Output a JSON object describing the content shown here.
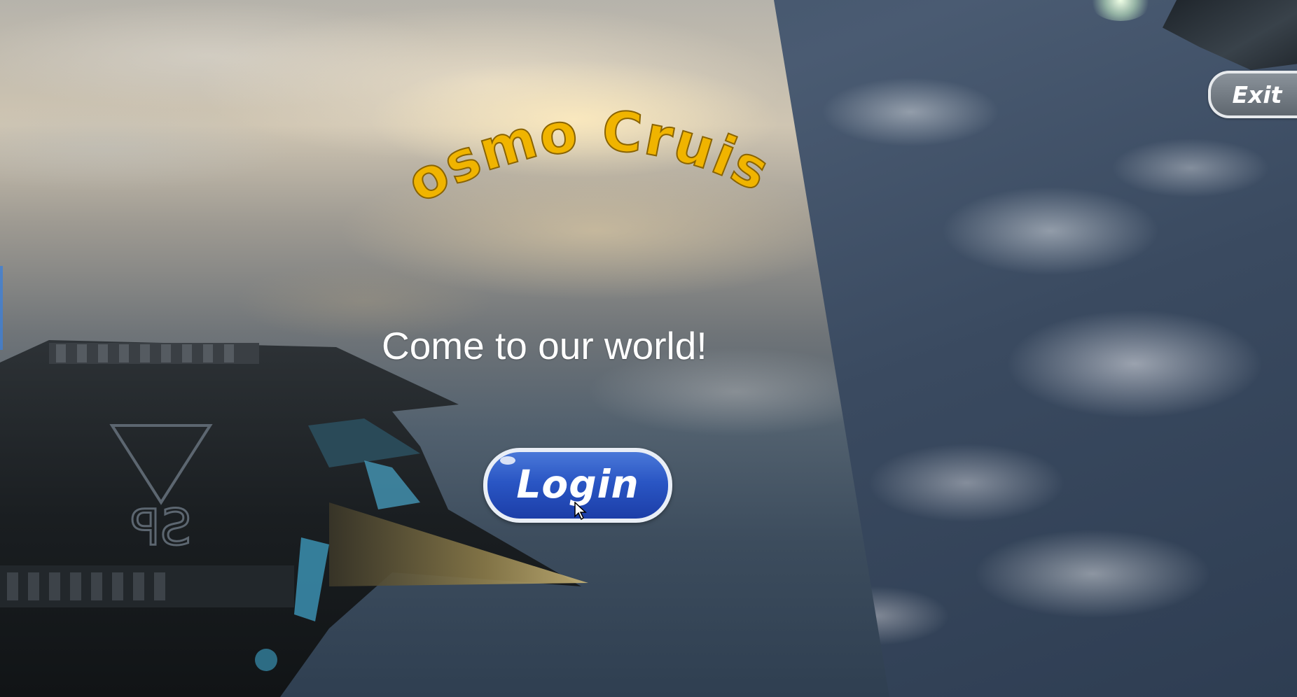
{
  "game": {
    "title": "Cosmo Cruise",
    "tagline": "Come to our world!",
    "login_label": "Login",
    "exit_label": "Exit",
    "ship_emblem_text": "SP"
  },
  "colors": {
    "title_gold": "#f0b400",
    "login_blue": "#2a56c4",
    "exit_grey": "#737b83"
  },
  "icons": {
    "cursor": "arrow-cursor-icon"
  }
}
